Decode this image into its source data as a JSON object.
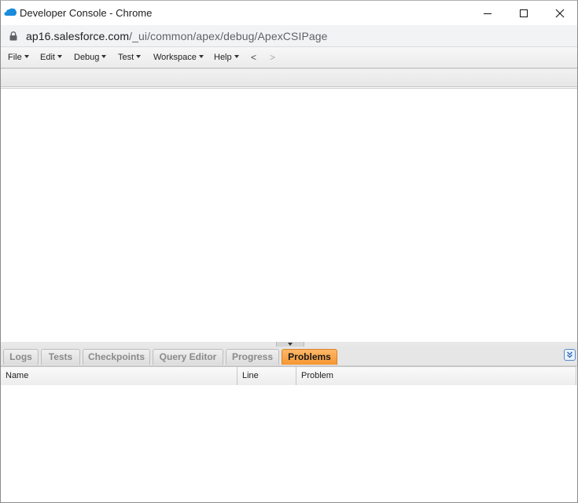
{
  "window": {
    "title": "Developer Console - Chrome",
    "url_host": "ap16.salesforce.com",
    "url_path": "/_ui/common/apex/debug/ApexCSIPage"
  },
  "menu": {
    "items": [
      {
        "label": "File"
      },
      {
        "label": "Edit"
      },
      {
        "label": "Debug"
      },
      {
        "label": "Test"
      },
      {
        "label": "Workspace"
      },
      {
        "label": "Help"
      }
    ],
    "back": "<",
    "forward": ">"
  },
  "panel": {
    "tabs": [
      {
        "label": "Logs"
      },
      {
        "label": "Tests"
      },
      {
        "label": "Checkpoints"
      },
      {
        "label": "Query Editor"
      },
      {
        "label": "Progress"
      },
      {
        "label": "Problems",
        "active": true
      }
    ],
    "columns": [
      "Name",
      "Line",
      "Problem"
    ]
  },
  "colors": {
    "active_tab": "#f5962f",
    "salesforce_blue": "#1a8cdb"
  },
  "icons": [
    "salesforce-cloud-icon",
    "lock-icon",
    "minimize-icon",
    "maximize-icon",
    "close-icon",
    "collapse-panel-icon"
  ]
}
